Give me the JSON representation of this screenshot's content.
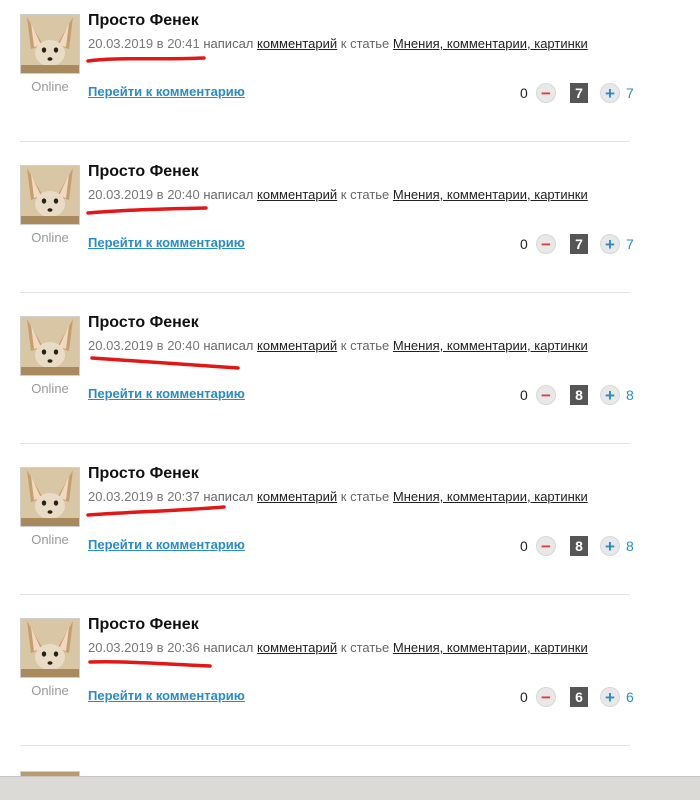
{
  "comments": [
    {
      "author": "Просто Фенек",
      "date": "20.03.2019 в 20:41",
      "wrote": "написал",
      "comment_link": "комментарий",
      "to_article": "к статье",
      "article_link": "Мнения, комментарии, картинки",
      "status": "Online",
      "goto_label": "Перейти к комментарию",
      "minus_count": "0",
      "score": "7",
      "plus_count": "7"
    },
    {
      "author": "Просто Фенек",
      "date": "20.03.2019 в 20:40",
      "wrote": "написал",
      "comment_link": "комментарий",
      "to_article": "к статье",
      "article_link": "Мнения, комментарии, картинки",
      "status": "Online",
      "goto_label": "Перейти к комментарию",
      "minus_count": "0",
      "score": "7",
      "plus_count": "7"
    },
    {
      "author": "Просто Фенек",
      "date": "20.03.2019 в 20:40",
      "wrote": "написал",
      "comment_link": "комментарий",
      "to_article": "к статье",
      "article_link": "Мнения, комментарии, картинки",
      "status": "Online",
      "goto_label": "Перейти к комментарию",
      "minus_count": "0",
      "score": "8",
      "plus_count": "8"
    },
    {
      "author": "Просто Фенек",
      "date": "20.03.2019 в 20:37",
      "wrote": "написал",
      "comment_link": "комментарий",
      "to_article": "к статье",
      "article_link": "Мнения, комментарии, картинки",
      "status": "Online",
      "goto_label": "Перейти к комментарию",
      "minus_count": "0",
      "score": "8",
      "plus_count": "8"
    },
    {
      "author": "Просто Фенек",
      "date": "20.03.2019 в 20:36",
      "wrote": "написал",
      "comment_link": "комментарий",
      "to_article": "к статье",
      "article_link": "Мнения, комментарии, картинки",
      "status": "Online",
      "goto_label": "Перейти к комментарию",
      "minus_count": "0",
      "score": "6",
      "plus_count": "6"
    }
  ],
  "buttons": {
    "minus_glyph": "−",
    "plus_glyph": "+"
  },
  "icons": {
    "avatar": "fennec-fox-avatar",
    "minus": "minus-circle-icon",
    "plus": "plus-circle-icon"
  },
  "colors": {
    "link_blue": "#2a8bc6",
    "minus_red": "#e03c3c",
    "score_bg": "#555555",
    "annotation_red": "#e01818"
  }
}
